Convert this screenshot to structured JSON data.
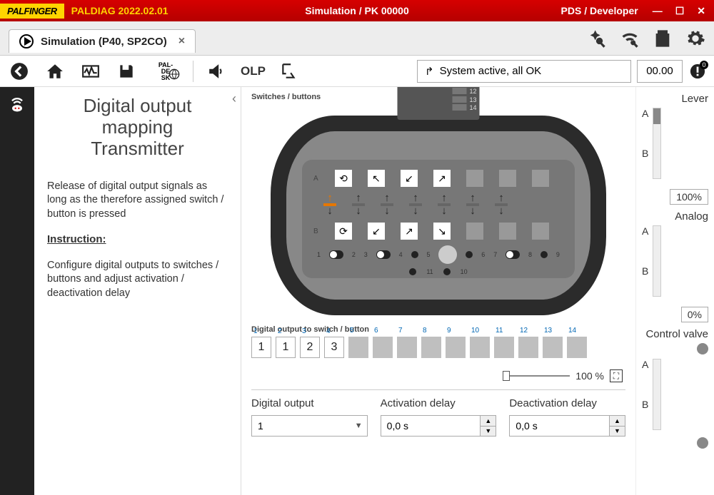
{
  "window": {
    "brand": "PALFINGER",
    "app": "PALDIAG 2022.02.01",
    "center": "Simulation / PK 00000",
    "right": "PDS / Developer"
  },
  "tab": {
    "label": "Simulation (P40, SP2CO)"
  },
  "toolbar": {
    "olp": "OLP",
    "status": "System active, all OK",
    "counter": "00.00",
    "alert_badge": "0"
  },
  "info": {
    "title_l1": "Digital output mapping",
    "title_l2": "Transmitter",
    "para1": "Release of digital output signals as long as the therefore assigned switch / button is pressed",
    "instr_h": "Instruction:",
    "para2": "Configure digital outputs to switches / buttons and adjust activation / deactivation delay"
  },
  "content": {
    "sec1": "Switches / buttons",
    "sec2": "Digital output to switch / button",
    "topnums": [
      "12",
      "13",
      "14"
    ],
    "rowA": "A",
    "rowB": "B",
    "botnums": [
      "1",
      "2",
      "3",
      "4",
      "5",
      "6",
      "7",
      "8",
      "9",
      "10",
      "11"
    ],
    "map_cells": [
      {
        "n": "1",
        "v": "1"
      },
      {
        "n": "2",
        "v": "1"
      },
      {
        "n": "3",
        "v": "2"
      },
      {
        "n": "4",
        "v": "3"
      },
      {
        "n": "5",
        "v": ""
      },
      {
        "n": "6",
        "v": ""
      },
      {
        "n": "7",
        "v": ""
      },
      {
        "n": "8",
        "v": ""
      },
      {
        "n": "9",
        "v": ""
      },
      {
        "n": "10",
        "v": ""
      },
      {
        "n": "11",
        "v": ""
      },
      {
        "n": "12",
        "v": ""
      },
      {
        "n": "13",
        "v": ""
      },
      {
        "n": "14",
        "v": ""
      }
    ],
    "zoom": "100 %"
  },
  "cfg": {
    "c1": "Digital output",
    "c2": "Activation delay",
    "c3": "Deactivation delay",
    "v1": "1",
    "v2": "0,0 s",
    "v3": "0,0 s"
  },
  "right": {
    "lever": "Lever",
    "analog": "Analog",
    "cv": "Control valve",
    "a": "A",
    "b": "B",
    "lever_val": "100%",
    "analog_val": "0%"
  }
}
